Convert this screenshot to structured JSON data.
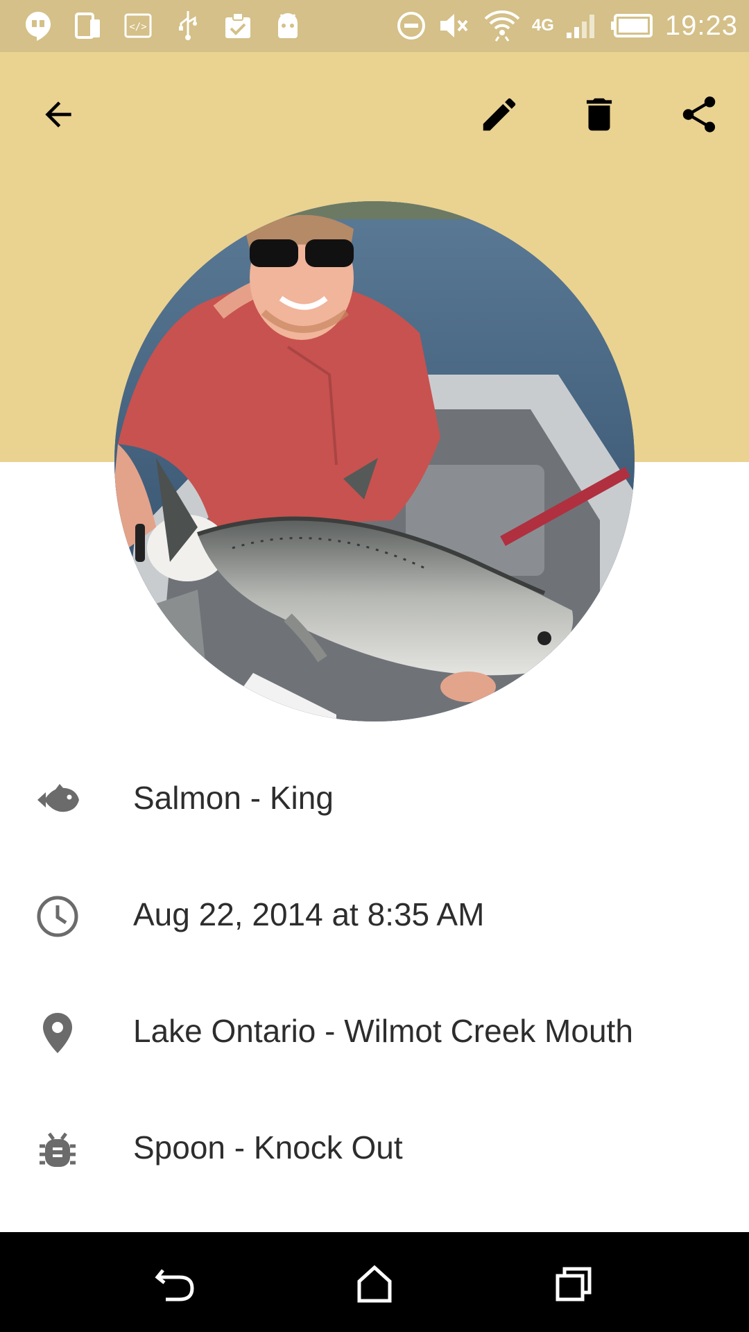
{
  "status_bar": {
    "time": "19:23",
    "network": "4G",
    "left_icons": [
      "hangouts-icon",
      "device-icon",
      "code-icon",
      "usb-icon",
      "clipboard-check-icon",
      "android-icon"
    ],
    "right_icons": [
      "do-not-disturb-icon",
      "muted-speaker-icon",
      "wifi-icon",
      "network-type-icon",
      "signal-icon",
      "battery-icon"
    ]
  },
  "toolbar": {
    "back_icon": "arrow-back-icon",
    "edit_icon": "pencil-icon",
    "delete_icon": "trash-icon",
    "share_icon": "share-icon"
  },
  "catch": {
    "species": "Salmon - King",
    "datetime": "Aug 22, 2014 at 8:35 AM",
    "location": "Lake Ontario - Wilmot Creek Mouth",
    "bait": "Spoon - Knock Out"
  },
  "colors": {
    "status_bar": "#d4c088",
    "header": "#ead291",
    "text": "#2d2d2d",
    "icon_gray": "#6b6b6b",
    "nav_bar": "#000000"
  },
  "nav_bar": {
    "back_icon": "nav-back-icon",
    "home_icon": "nav-home-icon",
    "recents_icon": "nav-recents-icon"
  }
}
